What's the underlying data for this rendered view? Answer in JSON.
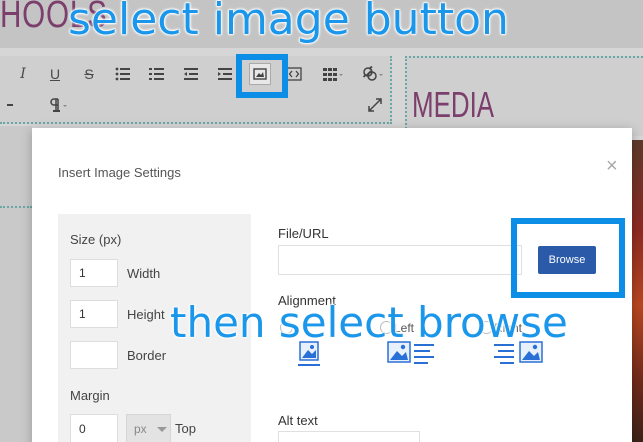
{
  "background": {
    "brand_text": "HOOLS",
    "media_title": "MEDIA",
    "toolbar": {
      "row1": [
        "I",
        "U",
        "S",
        "bulleted-list-icon",
        "numbered-list-icon",
        "outdent-icon",
        "indent-icon",
        "image-icon",
        "code-icon",
        "table-icon",
        "link-icon"
      ],
      "row2": [
        "minus-icon",
        "paragraph-icon",
        "expand-icon"
      ]
    }
  },
  "modal": {
    "title": "Insert Image Settings",
    "close_glyph": "×",
    "size_section": {
      "title": "Size (px)",
      "width_value": "1",
      "width_label": "Width",
      "height_value": "1",
      "height_label": "Height",
      "border_value": "",
      "border_label": "Border"
    },
    "margin_section": {
      "title": "Margin",
      "top_value": "0",
      "unit": "px",
      "top_label": "Top"
    },
    "file_url": {
      "label": "File/URL",
      "value": "",
      "browse_label": "Browse"
    },
    "alignment": {
      "label": "Alignment",
      "options": [
        {
          "label": "",
          "icon": "align-none-icon"
        },
        {
          "label": "Left",
          "icon": "align-left-icon"
        },
        {
          "label": "Right",
          "icon": "align-right-icon"
        }
      ]
    },
    "alt_text": {
      "label": "Alt text",
      "value": ""
    }
  },
  "annotations": {
    "top": "select image button",
    "bottom": "then select browse"
  },
  "colors": {
    "callout_blue": "#0d8ee6",
    "browse_blue": "#2a5aa8",
    "brand_purple": "#7c3e6d"
  }
}
